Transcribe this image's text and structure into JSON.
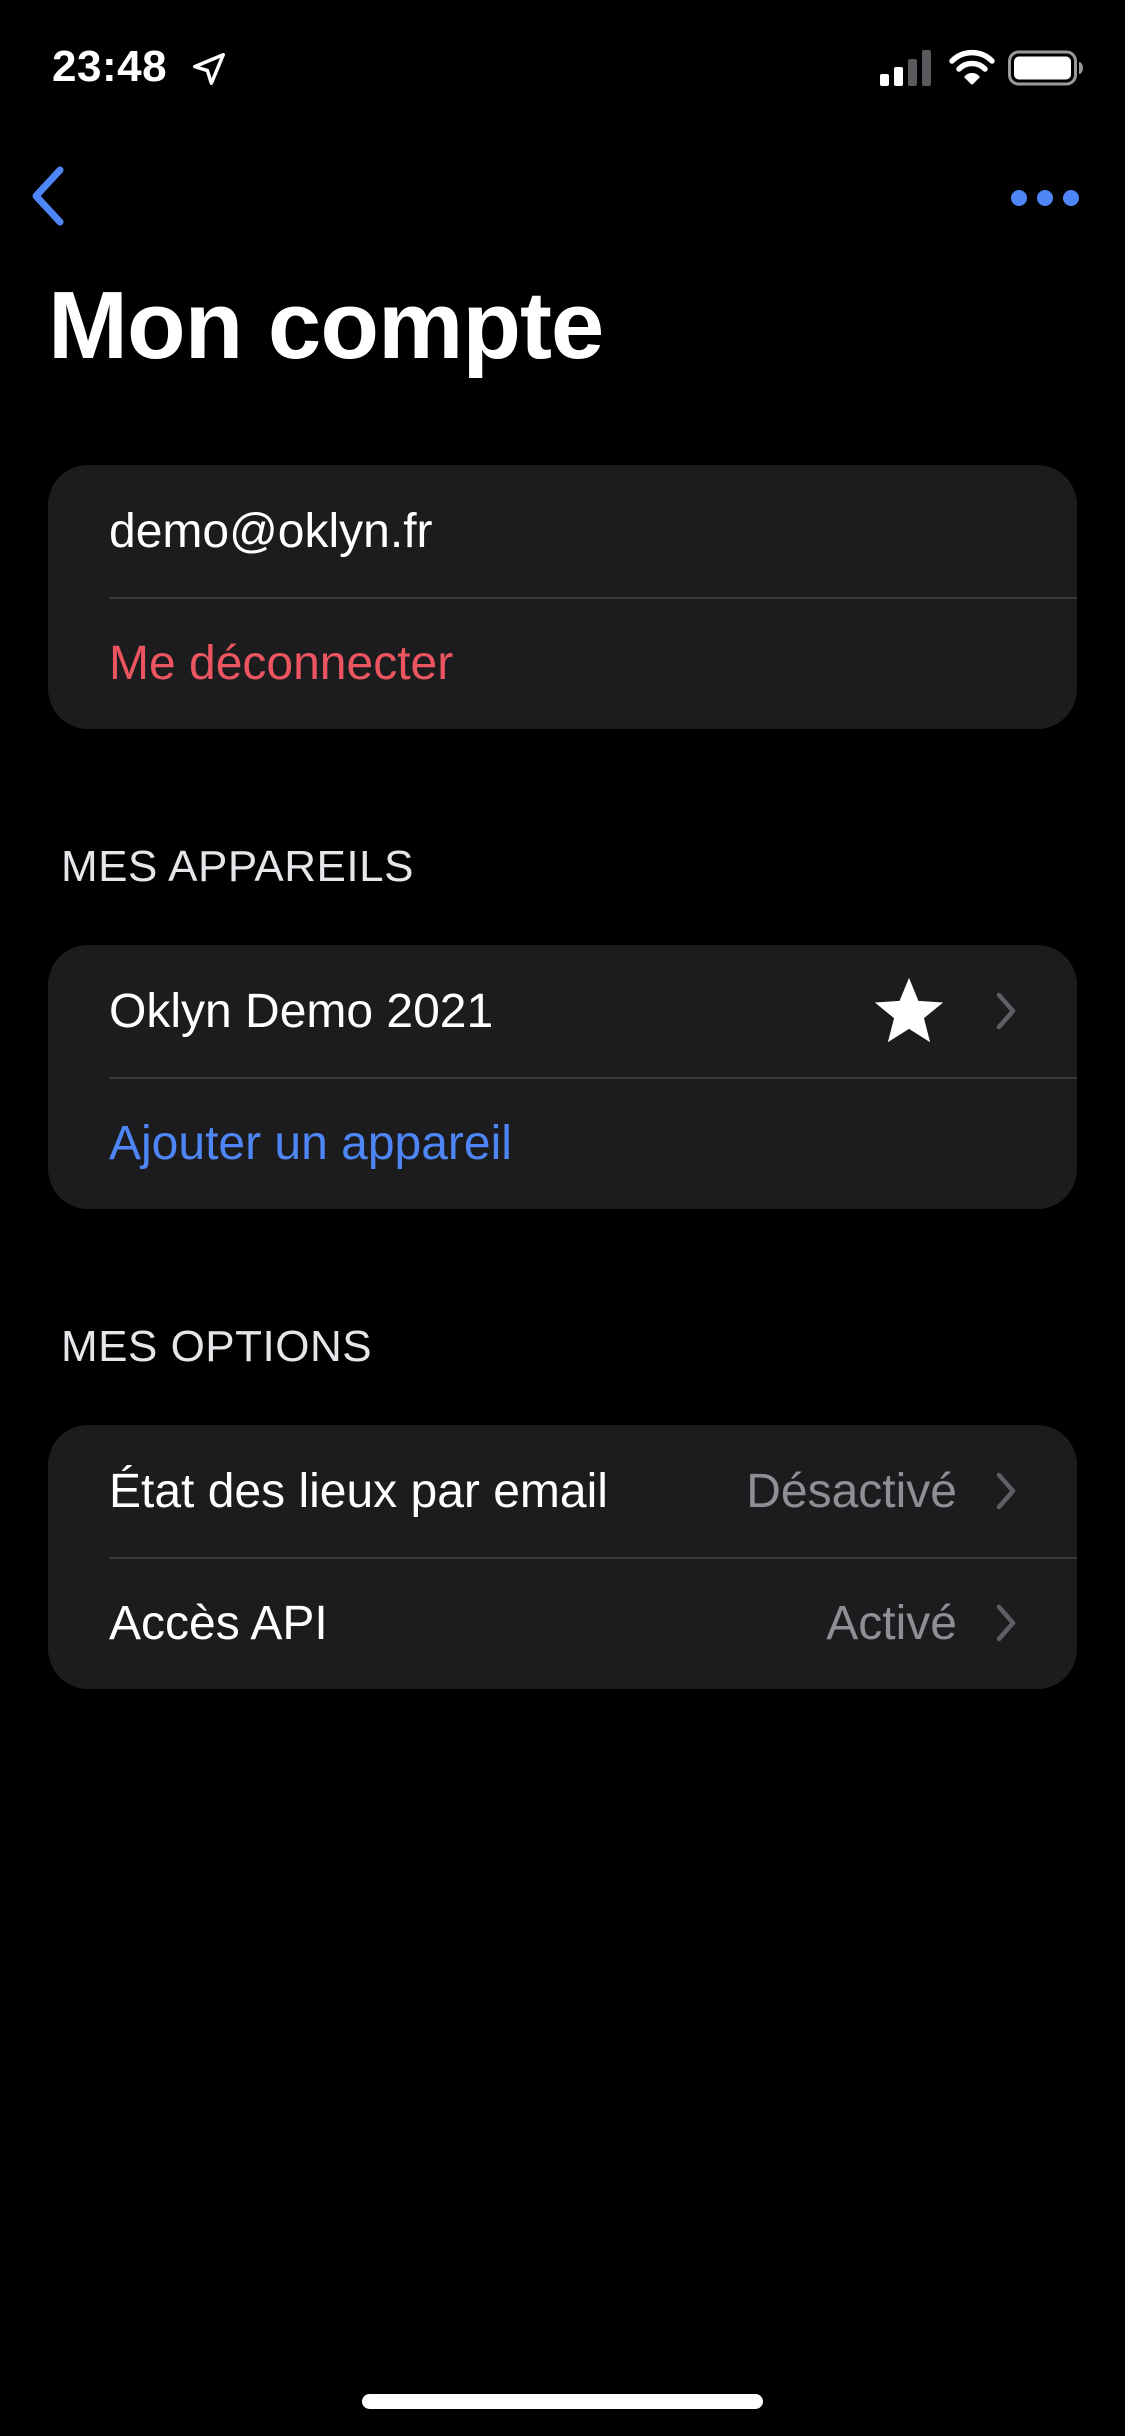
{
  "status_bar": {
    "time": "23:48",
    "icons": [
      "location-arrow-icon",
      "cellular-signal-icon",
      "wifi-icon",
      "battery-icon"
    ]
  },
  "nav": {
    "back_icon": "chevron-left-icon",
    "more_icon": "ellipsis-icon",
    "title": "Mon compte"
  },
  "account": {
    "email": "demo@oklyn.fr",
    "logout_label": "Me déconnecter"
  },
  "devices": {
    "header": "MES APPAREILS",
    "items": [
      {
        "label": "Oklyn Demo 2021",
        "favorite": true
      }
    ],
    "add_label": "Ajouter un appareil"
  },
  "options": {
    "header": "MES OPTIONS",
    "items": [
      {
        "label": "État des lieux par email",
        "value": "Désactivé"
      },
      {
        "label": "Accès API",
        "value": "Activé"
      }
    ]
  },
  "colors": {
    "background": "#000000",
    "card": "#1c1c1e",
    "accent_blue": "#4f86f7",
    "destructive_red": "#eb5560",
    "secondary_text": "#8e8e93"
  }
}
